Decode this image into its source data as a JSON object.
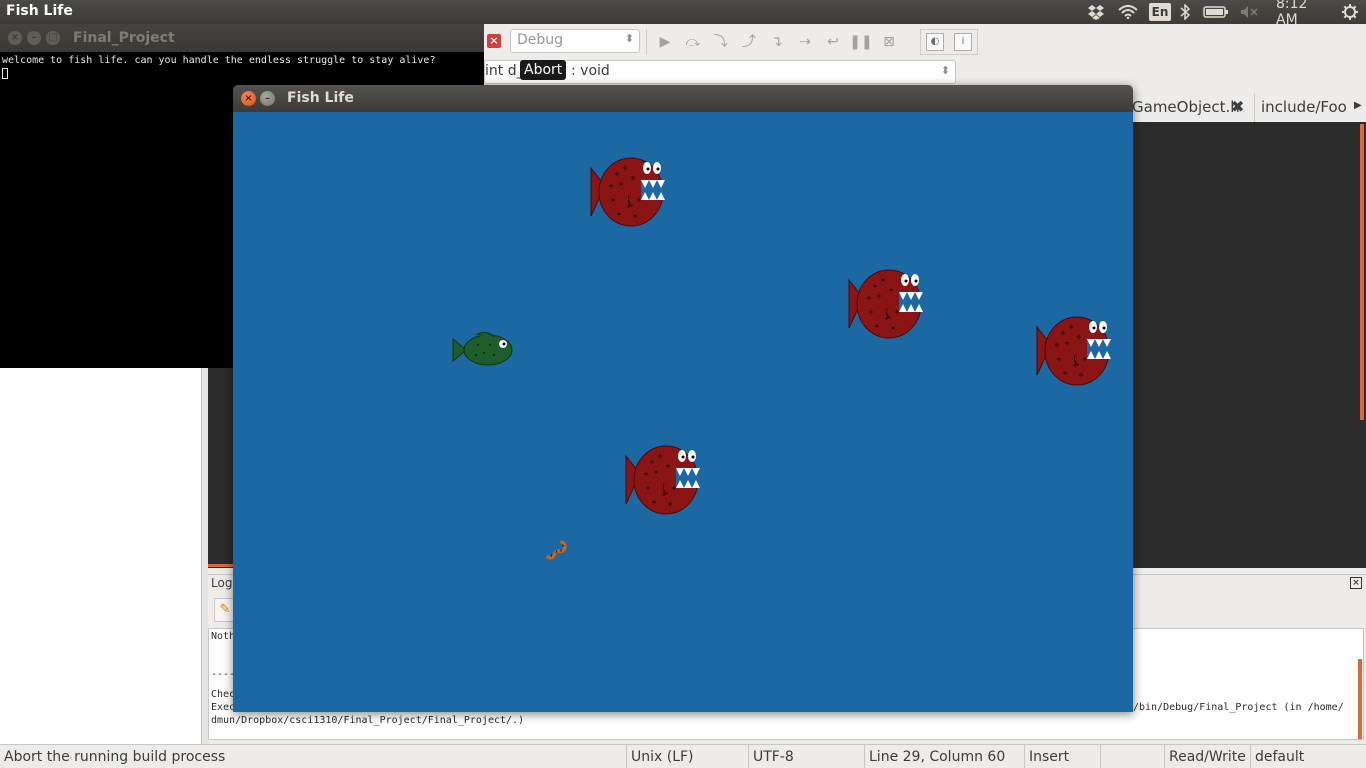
{
  "top_panel": {
    "app_title": "Fish Life",
    "keyboard_layout": "En",
    "clock": "8:12 AM",
    "icons": [
      "dropbox-icon",
      "wifi-icon",
      "bluetooth-icon",
      "battery-icon",
      "volume-muted-icon",
      "settings-gear-icon"
    ]
  },
  "terminal": {
    "title": "Final_Project",
    "output": "welcome to fish life. can you handle the endless struggle to stay alive?"
  },
  "ide": {
    "build_config": "Debug",
    "function_prefix": "int d_",
    "tooltip": "Abort",
    "function_suffix": ": void",
    "editor_tabs": [
      "GameObject.h",
      "include/Food"
    ],
    "logs_title": "Logs",
    "log_lines": [
      "Noth",
      "----",
      "Chec",
      "Exec",
      "/bin/Debug/Final_Project  (in /home/",
      "dmun/Dropbox/csci1310/Final_Project/Final_Project/.)"
    ]
  },
  "statusbar": {
    "message": "Abort the running build process",
    "line_endings": "Unix (LF)",
    "encoding": "UTF-8",
    "position": "Line 29, Column 60",
    "mode": "Insert",
    "access": "Read/Write",
    "profile": "default"
  },
  "game": {
    "title": "Fish Life",
    "background_color": "#1c68a3",
    "player_fish_color": "#1f5e2a",
    "piranha_color": "#8b1414",
    "worm_color": "#c1661c"
  }
}
